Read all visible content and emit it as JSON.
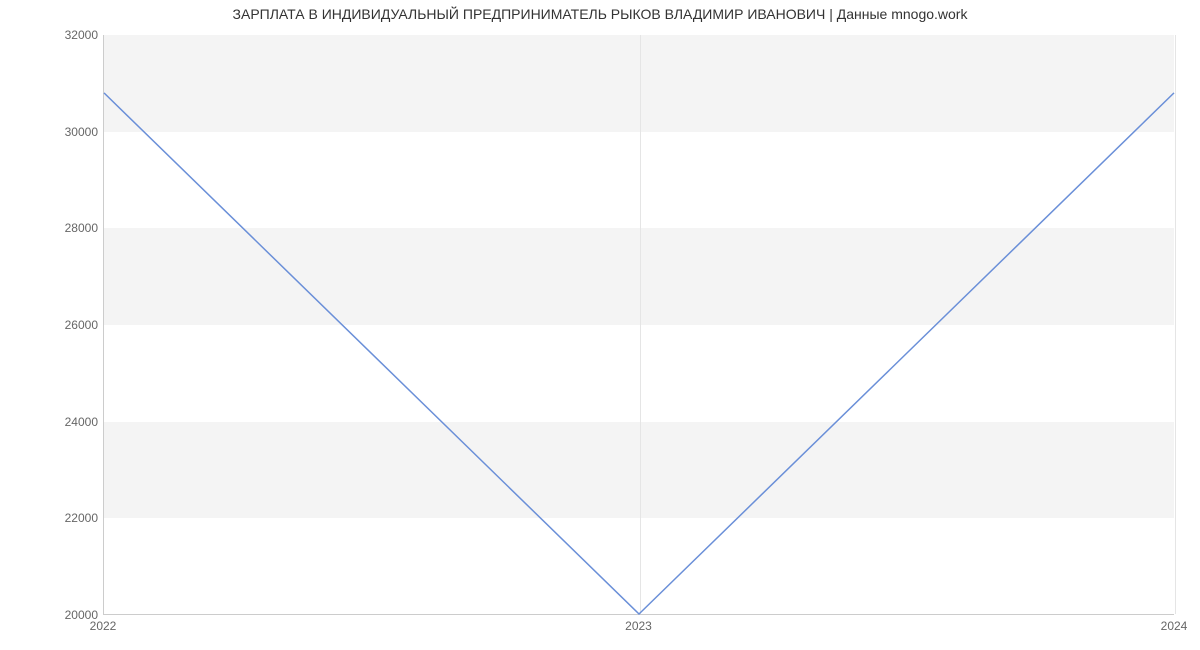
{
  "chart_data": {
    "type": "line",
    "title": "ЗАРПЛАТА В ИНДИВИДУАЛЬНЫЙ ПРЕДПРИНИМАТЕЛЬ РЫКОВ ВЛАДИМИР ИВАНОВИЧ | Данные mnogo.work",
    "x": [
      2022,
      2023,
      2024
    ],
    "values": [
      30800,
      20000,
      30800
    ],
    "xlabel": "",
    "ylabel": "",
    "ylim": [
      20000,
      32000
    ],
    "y_ticks": [
      20000,
      22000,
      24000,
      26000,
      28000,
      30000,
      32000
    ],
    "x_ticks": [
      2022,
      2023,
      2024
    ],
    "line_color": "#6a8fd8",
    "band_color": "#f4f4f4"
  }
}
